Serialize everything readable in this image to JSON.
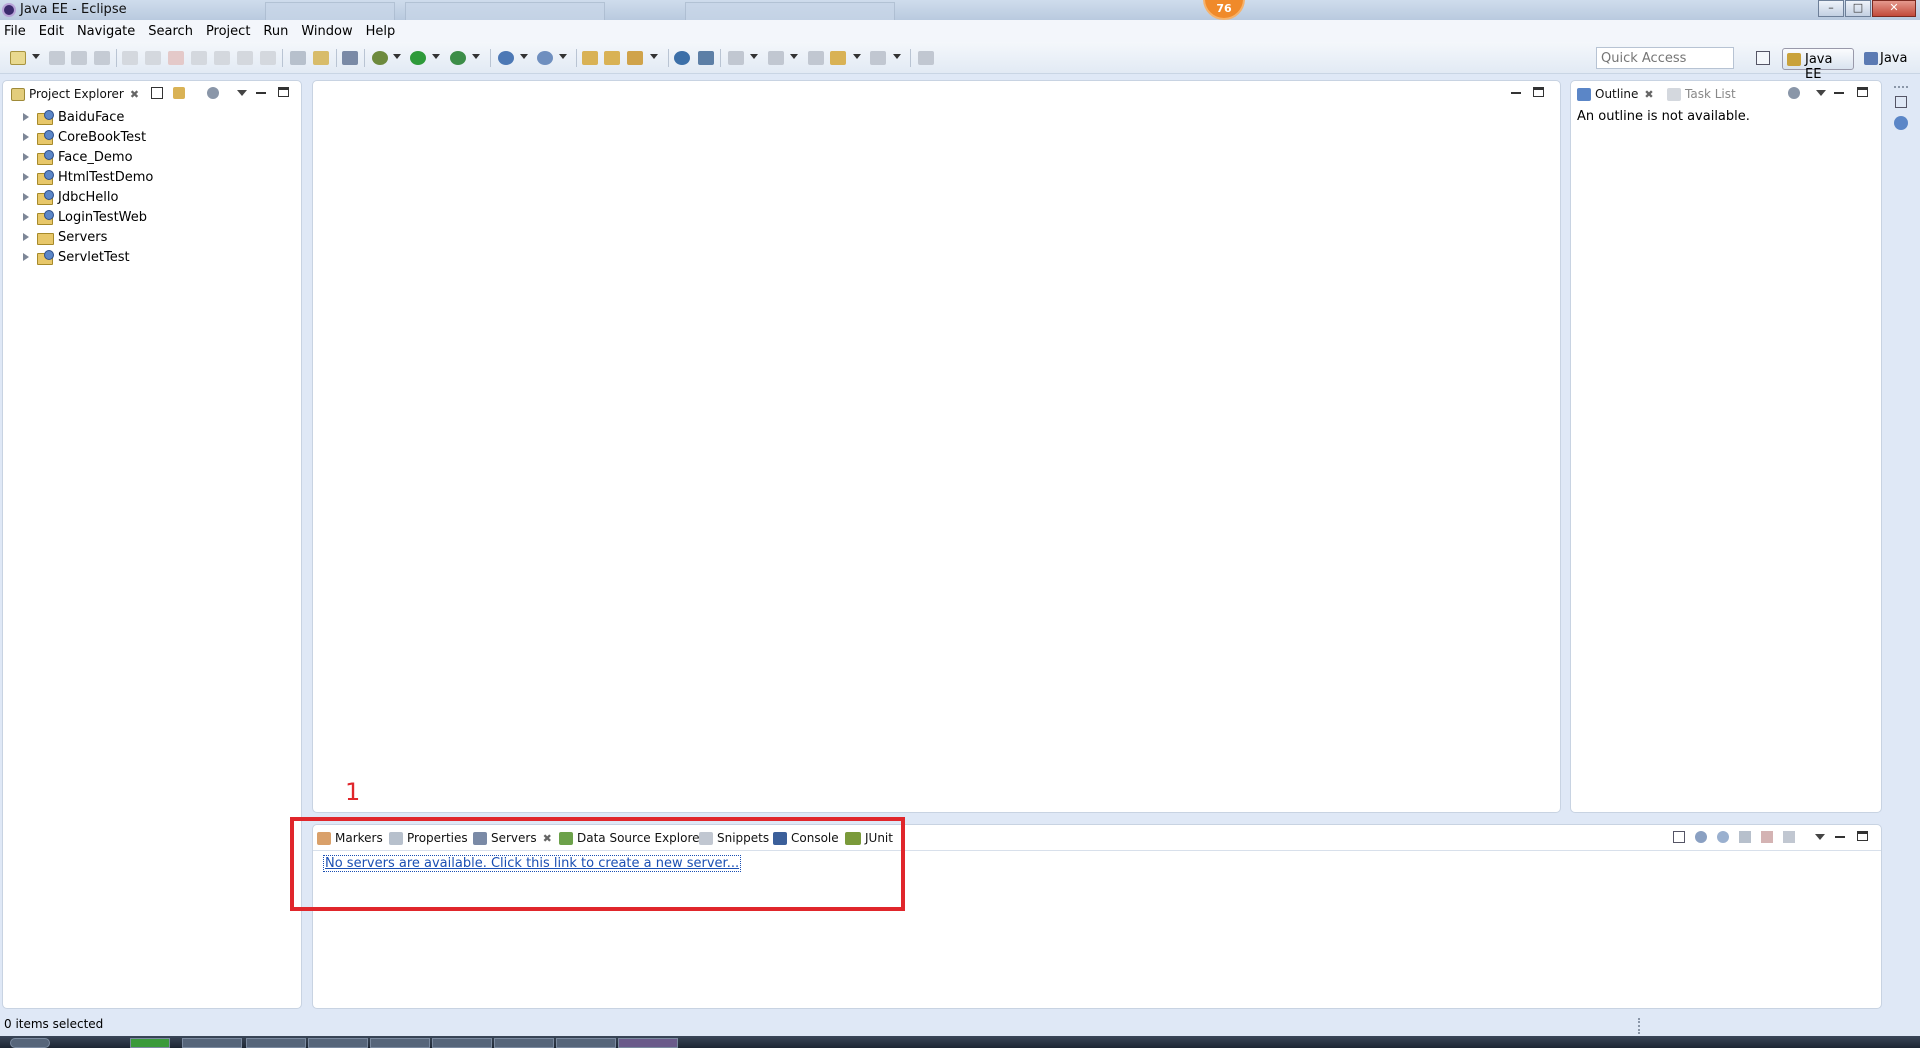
{
  "window": {
    "title": "Java EE - Eclipse",
    "badge": "76"
  },
  "menu": [
    "File",
    "Edit",
    "Navigate",
    "Search",
    "Project",
    "Run",
    "Window",
    "Help"
  ],
  "toolbar": {
    "quick_access_placeholder": "Quick Access"
  },
  "perspectives": {
    "java_ee": "Java EE",
    "java": "Java"
  },
  "project_explorer": {
    "tab_label": "Project Explorer",
    "projects": [
      "BaiduFace",
      "CoreBookTest",
      "Face_Demo",
      "HtmlTestDemo",
      "JdbcHello",
      "LoginTestWeb",
      "Servers",
      "ServletTest"
    ]
  },
  "outline": {
    "tab_label": "Outline",
    "task_list_label": "Task List",
    "message": "An outline is not available."
  },
  "bottom_panel": {
    "tabs": [
      "Markers",
      "Properties",
      "Servers",
      "Data Source Explorer",
      "Snippets",
      "Console",
      "JUnit"
    ],
    "servers_link": "No servers are available. Click this link to create a new server..."
  },
  "annotation": {
    "label": "1"
  },
  "status": {
    "text": "0 items selected"
  },
  "colors": {
    "annotation_red": "#e0262b",
    "link_blue": "#1a4fb3",
    "panel_bg": "#dfe8f6"
  }
}
